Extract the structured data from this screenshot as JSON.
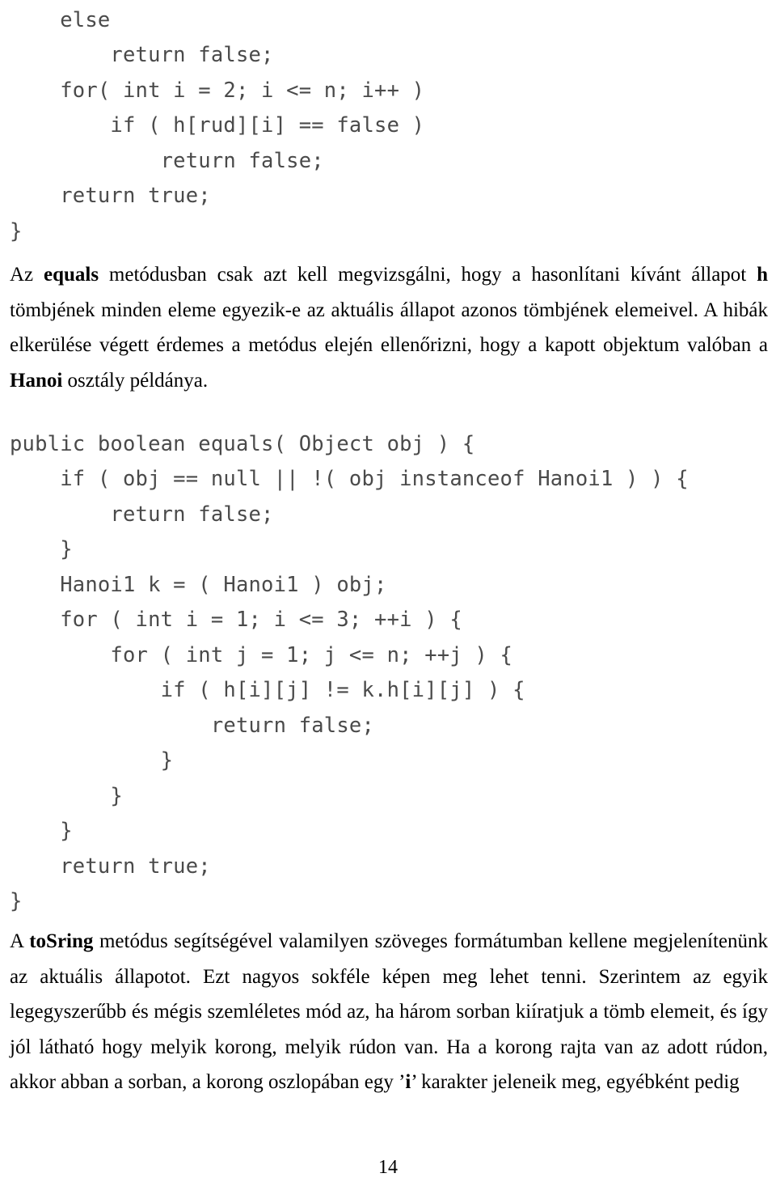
{
  "document": {
    "language": "hu",
    "page_number": "14",
    "body_font_color": "#000000",
    "code_font_color": "#4a4a4a"
  },
  "code_block_1": {
    "name": "isFinished-method-tail",
    "lines": [
      "    else",
      "        return false;",
      "    for( int i = 2; i <= n; i++ )",
      "        if ( h[rud][i] == false )",
      "            return false;",
      "    return true;",
      "}"
    ]
  },
  "para_equals": {
    "lines": [
      [
        {
          "t": "Az ",
          "b": false
        },
        {
          "t": "equals",
          "b": true
        },
        {
          "t": " metódusban csak azt kell megvizsgálni, hogy a hasonlítani kívánt állapot ",
          "b": false
        },
        {
          "t": "h",
          "b": true
        }
      ],
      [
        {
          "t": "tömbjének minden eleme egyezik-e az aktuális állapot azonos tömbjének elemeivel. A hibák",
          "b": false
        }
      ],
      [
        {
          "t": "elkerülése végett érdemes a metódus elején ellenőrizni, hogy a kapott objektum valóban a",
          "b": false
        }
      ],
      [
        {
          "t": "Hanoi",
          "b": true
        },
        {
          "t": " osztály példánya.",
          "b": false
        }
      ]
    ]
  },
  "code_block_2": {
    "name": "equals-method",
    "lines": [
      "public boolean equals( Object obj ) {",
      "    if ( obj == null || !( obj instanceof Hanoi1 ) ) {",
      "        return false;",
      "    }",
      "    Hanoi1 k = ( Hanoi1 ) obj;",
      "    for ( int i = 1; i <= 3; ++i ) {",
      "        for ( int j = 1; j <= n; ++j ) {",
      "            if ( h[i][j] != k.h[i][j] ) {",
      "                return false;",
      "            }",
      "        }",
      "    }",
      "    return true;",
      "}"
    ]
  },
  "para_tostring": {
    "lines": [
      [
        {
          "t": "A ",
          "b": false
        },
        {
          "t": "toSring",
          "b": true
        },
        {
          "t": " metódus segítségével valamilyen szöveges formátumban kellene megjelenítenünk",
          "b": false
        }
      ],
      [
        {
          "t": "az aktuális állapotot. Ezt nagyos sokféle képen meg lehet tenni. Szerintem az egyik",
          "b": false
        }
      ],
      [
        {
          "t": "legegyszerűbb és mégis szemléletes mód az, ha három sorban kiíratjuk a tömb elemeit, és így",
          "b": false
        }
      ],
      [
        {
          "t": "jól látható hogy melyik korong, melyik rúdon van. Ha a korong rajta van az adott rúdon,",
          "b": false
        }
      ],
      [
        {
          "t": "akkor abban a sorban, a korong oszlopában egy ’",
          "b": false
        },
        {
          "t": "i",
          "b": true
        },
        {
          "t": "’ karakter jeleneik meg, egyébként pedig",
          "b": false
        }
      ]
    ]
  },
  "footer": {
    "page_number": "14"
  }
}
